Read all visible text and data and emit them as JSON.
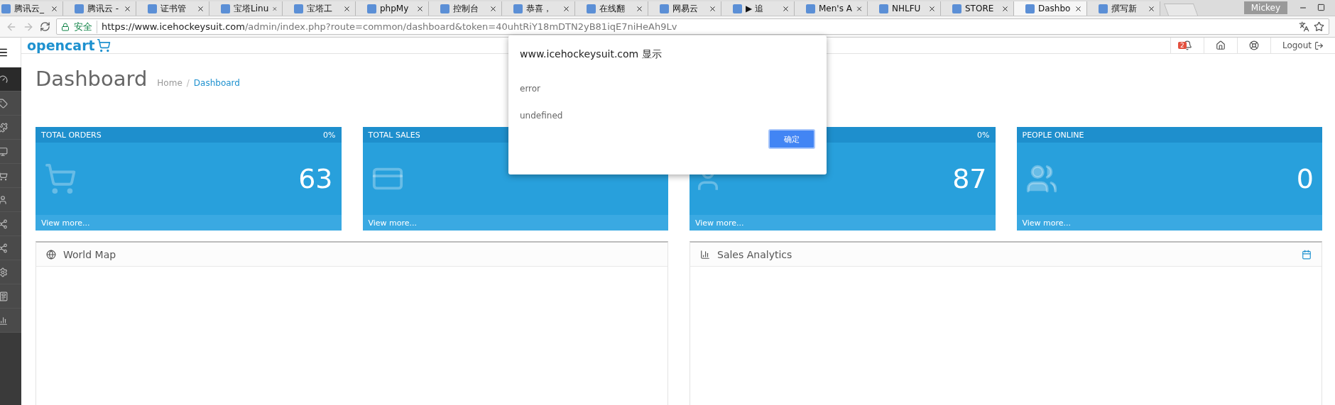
{
  "browser": {
    "tabs": [
      {
        "label": "腾讯云_",
        "selected": false
      },
      {
        "label": "腾讯云 -",
        "selected": false
      },
      {
        "label": "证书管",
        "selected": false
      },
      {
        "label": "宝塔Linu",
        "selected": false
      },
      {
        "label": "宝塔工",
        "selected": false
      },
      {
        "label": "phpMy",
        "selected": false
      },
      {
        "label": "控制台",
        "selected": false
      },
      {
        "label": "恭喜，",
        "selected": false
      },
      {
        "label": "在线翻",
        "selected": false
      },
      {
        "label": "网易云",
        "selected": false
      },
      {
        "label": "▶ 追",
        "selected": false
      },
      {
        "label": "Men's A",
        "selected": false
      },
      {
        "label": "NHLFU",
        "selected": false
      },
      {
        "label": "STORE",
        "selected": false
      },
      {
        "label": "Dashbo",
        "selected": true
      },
      {
        "label": "撰写新",
        "selected": false
      }
    ],
    "profile": "Mickey",
    "address": {
      "secure_label": "安全",
      "host": "https://www.icehockeysuit.com",
      "path": "/admin/index.php?route=common/dashboard&token=40uhtRiY18mDTN2yB81iqE7niHeAh9Lv"
    }
  },
  "sidebar": {
    "items": [
      {
        "kind": "dashboard",
        "selected": true
      },
      {
        "kind": "catalog",
        "selected": false
      },
      {
        "kind": "extensions",
        "selected": false
      },
      {
        "kind": "design",
        "selected": false
      },
      {
        "kind": "sales",
        "selected": false
      },
      {
        "kind": "customers",
        "selected": false
      },
      {
        "kind": "marketing",
        "selected": false
      },
      {
        "kind": "share",
        "selected": false
      },
      {
        "kind": "system",
        "selected": false
      },
      {
        "kind": "reports",
        "selected": false
      },
      {
        "kind": "stats",
        "selected": false
      }
    ]
  },
  "header": {
    "logo": "opencart",
    "notification_count": "2",
    "logout": "Logout"
  },
  "page": {
    "title": "Dashboard",
    "breadcrumb_separator": "/",
    "breadcrumbs": [
      {
        "label": "Home",
        "selected": false
      },
      {
        "label": "Dashboard",
        "selected": true
      }
    ]
  },
  "tiles": [
    {
      "kind": "orders",
      "title": "TOTAL ORDERS",
      "percent": "0%",
      "value": "63",
      "footer": "View more..."
    },
    {
      "kind": "sales",
      "title": "TOTAL SALES",
      "footer": "View more..."
    },
    {
      "kind": "customers",
      "percent": "0%",
      "value": "87",
      "footer": "View more..."
    },
    {
      "kind": "online",
      "title": "PEOPLE ONLINE",
      "value": "0",
      "footer": "View more..."
    }
  ],
  "panels": [
    {
      "kind": "map",
      "title": "World Map"
    },
    {
      "kind": "chart",
      "title": "Sales Analytics"
    }
  ],
  "dialog": {
    "title": "www.icehockeysuit.com 显示",
    "lines": [
      "error",
      "undefined"
    ],
    "button": "确定"
  }
}
